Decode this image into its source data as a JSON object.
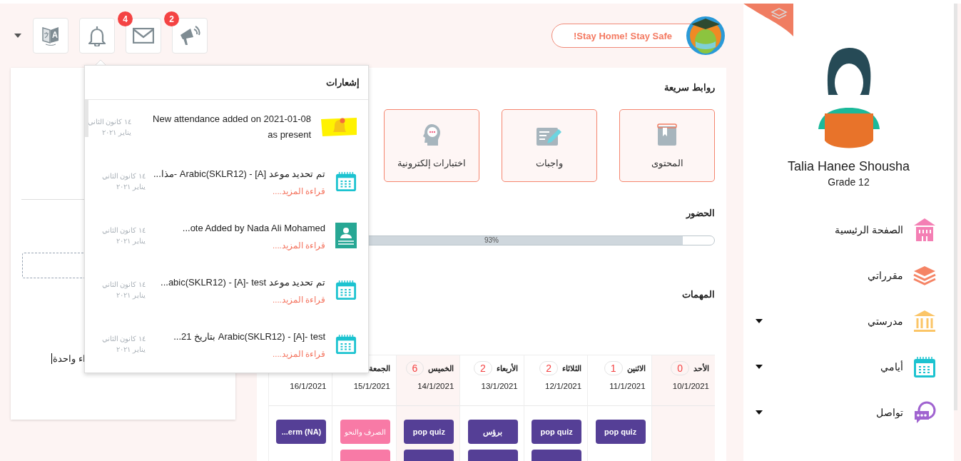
{
  "header": {
    "buttons": [
      {
        "kind": "megaphone",
        "badge": "2"
      },
      {
        "kind": "mail",
        "badge": "4"
      },
      {
        "kind": "bell"
      },
      {
        "kind": "translate"
      }
    ],
    "banner": "!Stay Home! Stay Safe"
  },
  "notifications": {
    "title": "إشعارات",
    "items": [
      {
        "kind": "alert",
        "title": "New attendance added on 2021-01-08 as present",
        "date": "١٤ كانون الثاني يناير ٢٠٢١"
      },
      {
        "kind": "calendar",
        "title": "تم تحديد موعد Arabic(SKLR12) - [A] -مذا...",
        "more": "قراءة المزيد....",
        "date": "١٤ كانون الثاني يناير ٢٠٢١"
      },
      {
        "kind": "note",
        "title": "ote Added by Nada Ali Mohamed...",
        "more": "قراءة المزيد....",
        "date": "١٤ كانون الثاني يناير ٢٠٢١"
      },
      {
        "kind": "calendar",
        "title": "تم تحديد موعد abic(SKLR12) - [A]- test...",
        "more": "قراءة المزيد....",
        "date": "١٤ كانون الثاني يناير ٢٠٢١"
      },
      {
        "kind": "calendar",
        "title": "Arabic(SKLR12) - [A]- test بتاريخ 21...",
        "more": "قراءة المزيد....",
        "date": "١٤ كانون الثاني يناير ٢٠٢١"
      }
    ]
  },
  "left_card": {
    "text": "اء واحدة"
  },
  "quick_links": {
    "title": "روابط سريعة",
    "items": [
      {
        "kind": "content",
        "label": "المحتوى"
      },
      {
        "kind": "homework",
        "label": "واجبات"
      },
      {
        "kind": "exams",
        "label": "اختبارات إلكترونية"
      }
    ]
  },
  "attendance": {
    "title": "الحضور",
    "level": 0.93,
    "reading": "93%"
  },
  "tasks": {
    "title": "المهمات",
    "columns": [
      {
        "day": "الأحد",
        "count": "0",
        "date": "10/1/2021",
        "highlighted": true
      },
      {
        "day": "الاثنين",
        "count": "1",
        "date": "11/1/2021",
        "highlighted": false,
        "tasks": [
          {
            "kind": "quiz",
            "title": "pop quiz"
          }
        ]
      },
      {
        "day": "الثلاثاء",
        "count": "2",
        "date": "12/1/2021",
        "highlighted": false,
        "tasks": [
          {
            "kind": "quiz",
            "title": "pop quiz"
          },
          {
            "kind": "quiz"
          }
        ]
      },
      {
        "day": "الأربعاء",
        "count": "2",
        "date": "13/1/2021",
        "highlighted": false,
        "tasks": [
          {
            "kind": "quiz",
            "title": "برؤس"
          },
          {
            "kind": "quiz"
          }
        ]
      },
      {
        "day": "الخميس",
        "count": "6",
        "date": "14/1/2021",
        "highlighted": true,
        "tasks": [
          {
            "kind": "quiz",
            "title": "pop quiz"
          },
          {
            "kind": "quiz"
          }
        ]
      },
      {
        "day": "الجمعة",
        "date": "15/1/2021",
        "highlighted": false,
        "tasks": [
          {
            "kind": "lesson",
            "title": "الصرف والنحو"
          },
          {
            "kind": "lesson"
          }
        ]
      },
      {
        "date": "16/1/2021",
        "highlighted": false,
        "tasks": [
          {
            "kind": "quiz",
            "title": "...erm (NA)"
          }
        ]
      }
    ]
  },
  "profile": {
    "name": "Talia Hanee Shousha",
    "grade": "Grade 12"
  },
  "nav": [
    {
      "kind": "home",
      "label": "الصفحة الرئيسية",
      "has_submenu": false
    },
    {
      "kind": "courses",
      "label": "مقرراتي",
      "has_submenu": false
    },
    {
      "kind": "school",
      "label": "مدرستي",
      "has_submenu": true
    },
    {
      "kind": "days",
      "label": "أيامي",
      "has_submenu": true
    },
    {
      "kind": "contact",
      "label": "تواصل",
      "has_submenu": true
    }
  ]
}
